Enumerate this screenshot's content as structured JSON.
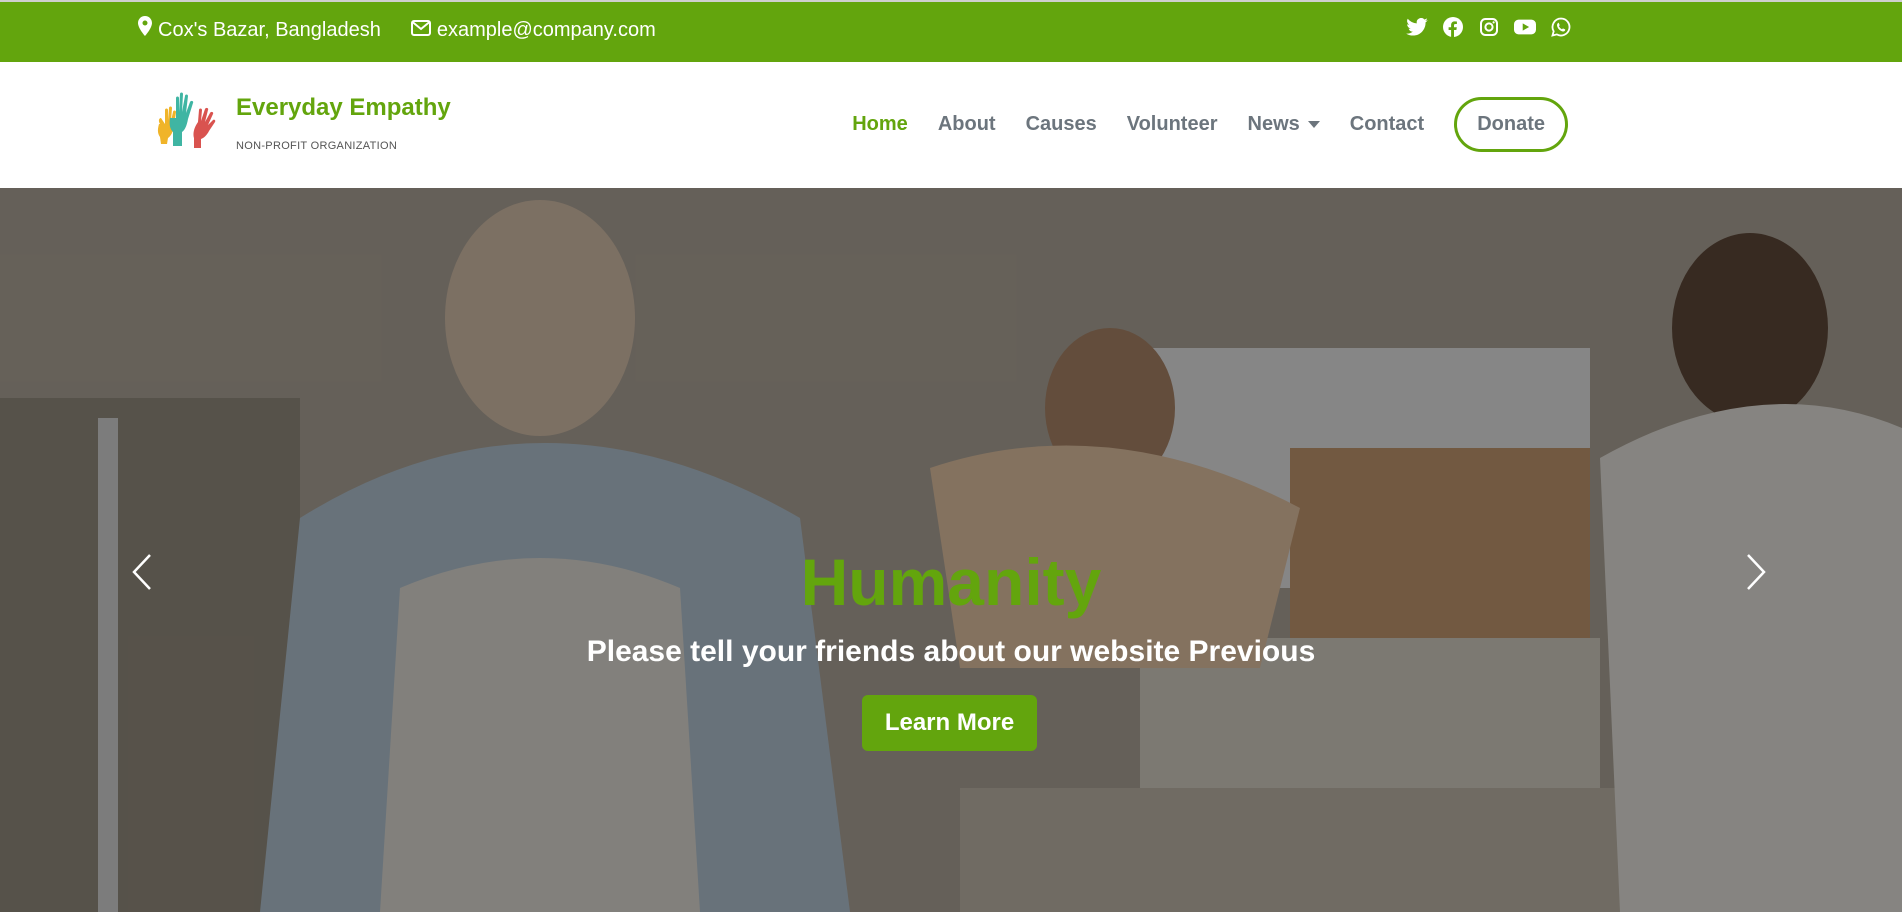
{
  "topbar": {
    "location": "Cox's Bazar, Bangladesh",
    "email": "example@company.com",
    "bg_color": "#63a50d",
    "social_icons": [
      "twitter-icon",
      "facebook-icon",
      "instagram-icon",
      "youtube-icon",
      "whatsapp-icon"
    ]
  },
  "brand": {
    "name": "Everyday Empathy",
    "tagline": "NON-PROFIT ORGANIZATION",
    "logo_icon": "raised-hands-icon"
  },
  "nav": {
    "items": [
      {
        "label": "Home",
        "active": true
      },
      {
        "label": "About"
      },
      {
        "label": "Causes"
      },
      {
        "label": "Volunteer"
      },
      {
        "label": "News",
        "dropdown": true
      },
      {
        "label": "Contact"
      }
    ],
    "donate_label": "Donate",
    "accent": "#63a50d"
  },
  "hero": {
    "title": "Humanity",
    "subtitle": "Please tell your friends about our website Previous",
    "button_label": "Learn More",
    "prev_icon": "chevron-left-icon",
    "next_icon": "chevron-right-icon"
  }
}
